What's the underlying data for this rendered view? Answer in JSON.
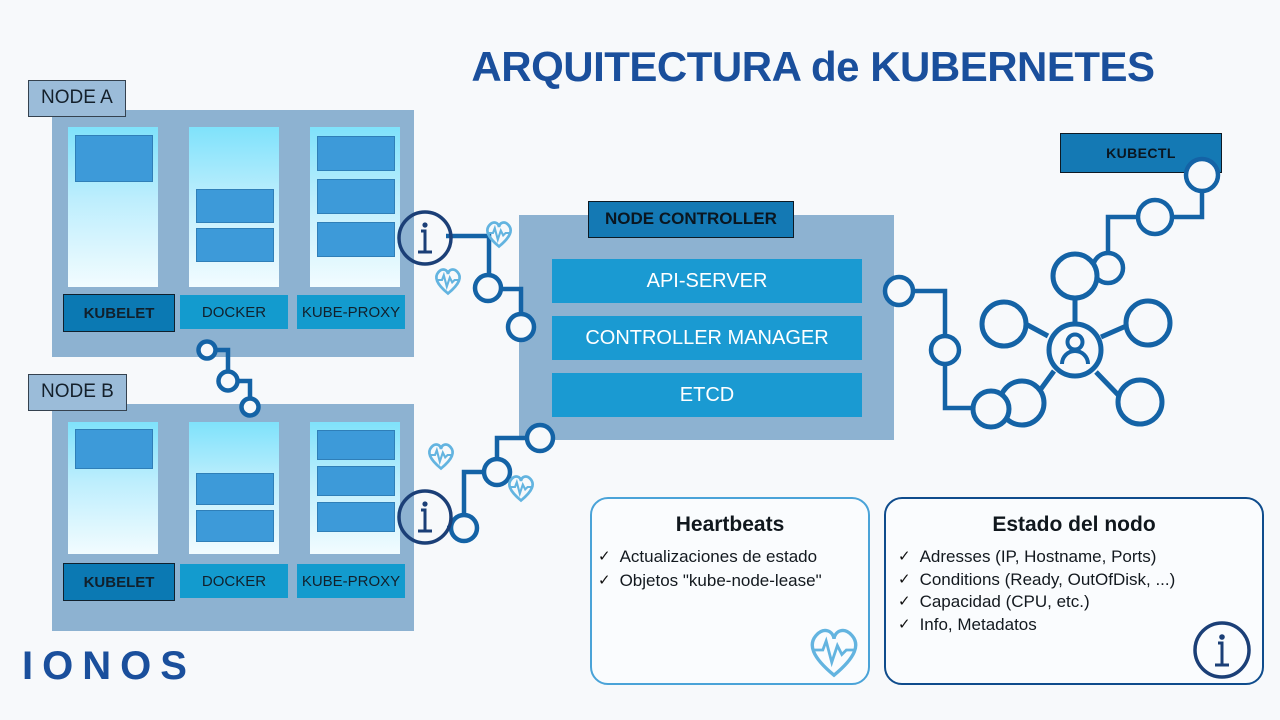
{
  "title": "ARQUITECTURA de KUBERNETES",
  "brand": {
    "logo_text": "IONOS",
    "accent_color": "#1a4f9c"
  },
  "colors": {
    "title_blue": "#1a4f9c",
    "node_panel": "#8db2d1",
    "pod_box": "#3d9ad9",
    "component_box": "#139bce",
    "component_primary": "#0b79b3",
    "controller_row": "#1a9ad2",
    "wire_blue": "#1463a6",
    "heart_icon": "#63b4e0",
    "card_border_light": "#4aa3d8",
    "card_border_dark": "#0f4c8c",
    "background": "#f7f9fb"
  },
  "nodes": [
    {
      "label": "NODE A",
      "components": [
        {
          "name": "KUBELET",
          "primary": true
        },
        {
          "name": "DOCKER",
          "primary": false
        },
        {
          "name": "KUBE-PROXY",
          "primary": false
        }
      ],
      "pod_counts": [
        1,
        2,
        3
      ]
    },
    {
      "label": "NODE B",
      "components": [
        {
          "name": "KUBELET",
          "primary": true
        },
        {
          "name": "DOCKER",
          "primary": false
        },
        {
          "name": "KUBE-PROXY",
          "primary": false
        }
      ],
      "pod_counts": [
        1,
        2,
        3
      ]
    }
  ],
  "node_controller": {
    "title": "NODE CONTROLLER",
    "rows": [
      "API-SERVER",
      "CONTROLLER MANAGER",
      "ETCD"
    ]
  },
  "kubectl": {
    "label": "KUBECTL"
  },
  "cards": [
    {
      "title": "Heartbeats",
      "items": [
        "Actualizaciones de estado",
        "Objetos \"kube-node-lease\""
      ],
      "icon": "heartbeat-icon"
    },
    {
      "title": "Estado del nodo",
      "items": [
        "Adresses (IP, Hostname, Ports)",
        "Conditions (Ready, OutOfDisk, ...)",
        "Capacidad (CPU, etc.)",
        "Info, Metadatos"
      ],
      "icon": "info-icon"
    }
  ],
  "check_glyph": "✓"
}
